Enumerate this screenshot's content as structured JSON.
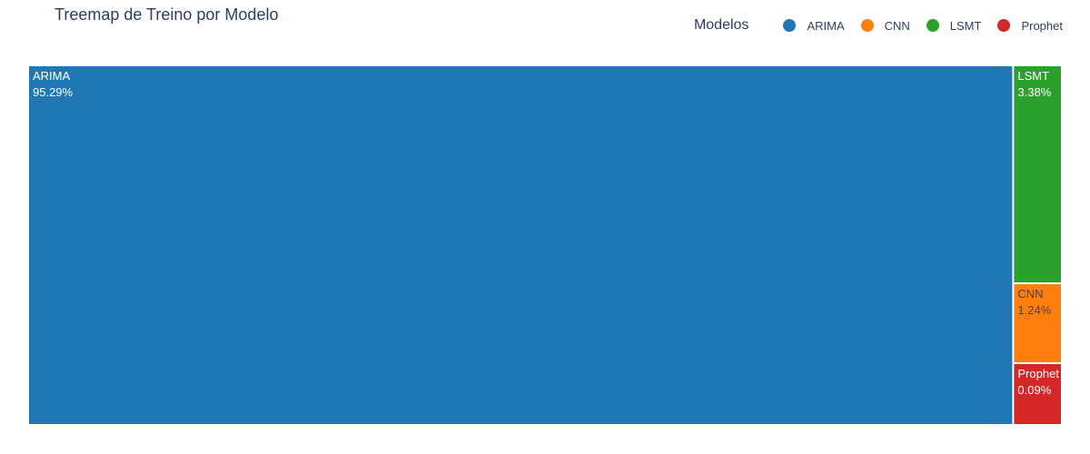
{
  "title": "Treemap de Treino por Modelo",
  "legend": {
    "title": "Modelos",
    "items": [
      {
        "name": "ARIMA",
        "color": "#1f77b4"
      },
      {
        "name": "CNN",
        "color": "#ff7f0e"
      },
      {
        "name": "LSMT",
        "color": "#2ca02c"
      },
      {
        "name": "Prophet",
        "color": "#d62728"
      }
    ]
  },
  "chart_data": {
    "type": "treemap",
    "title": "Treemap de Treino por Modelo",
    "legend_title": "Modelos",
    "legend_placement": "top-right",
    "items": [
      {
        "name": "ARIMA",
        "percent_label": "95.29%",
        "value": 95.29,
        "color": "#1f77b4",
        "text_color": "#ffffff"
      },
      {
        "name": "LSMT",
        "percent_label": "3.38%",
        "value": 3.38,
        "color": "#2ca02c",
        "text_color": "#ffffff"
      },
      {
        "name": "CNN",
        "percent_label": "1.24%",
        "value": 1.24,
        "color": "#ff7f0e",
        "text_color": "#444444"
      },
      {
        "name": "Prophet",
        "percent_label": "0.09%",
        "value": 0.09,
        "color": "#d62728",
        "text_color": "#ffffff"
      }
    ]
  }
}
